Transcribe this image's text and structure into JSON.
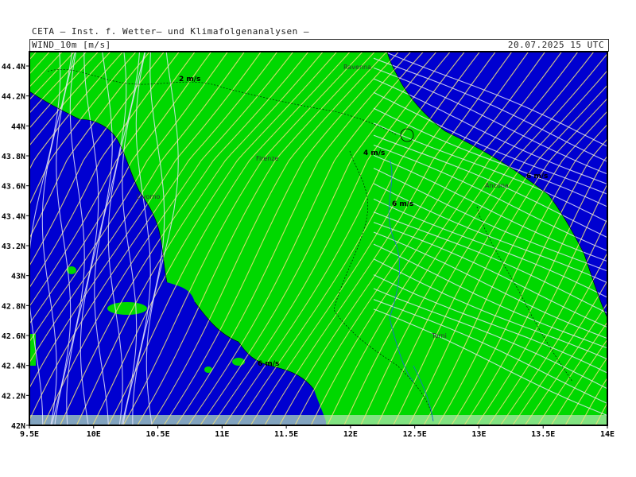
{
  "header": {
    "title": "CETA – Inst. f. Wetter– und Klimafolgenanalysen –",
    "variable": "WIND_10m [m/s]",
    "datetime": "20.07.2025 15 UTC"
  },
  "axes": {
    "lat_labels": [
      "44.4N",
      "44.2N",
      "44N",
      "43.8N",
      "43.6N",
      "43.4N",
      "43.2N",
      "43N",
      "42.8N",
      "42.6N",
      "42.4N",
      "42.2N",
      "42N"
    ],
    "lon_labels": [
      "9.5E",
      "10E",
      "10.5E",
      "11E",
      "11.5E",
      "12E",
      "12.5E",
      "13E",
      "13.5E",
      "14E"
    ]
  },
  "cities": [
    {
      "name": "Ravenna"
    },
    {
      "name": "Firenze"
    },
    {
      "name": "Livorno"
    },
    {
      "name": "Ancona"
    },
    {
      "name": "Terni"
    }
  ],
  "contour_labels": [
    "2 m/s",
    "4 m/s",
    "6 m/s",
    "6 m/s",
    "6 m/s"
  ],
  "colors": {
    "low_wind": "#0000d0",
    "mid_wind": "#00d800",
    "streamline_low": "#e8e8ff",
    "streamline_mid": "#f2e07a",
    "border": "#000000"
  }
}
